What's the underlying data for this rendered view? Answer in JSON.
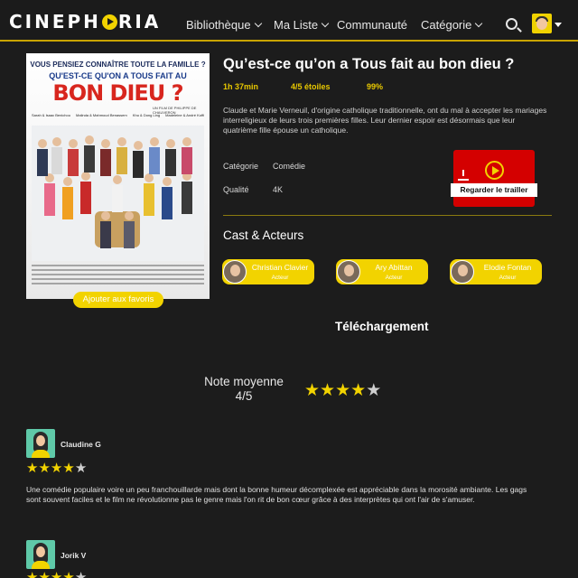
{
  "nav": {
    "logo": [
      "CINEPH",
      "RIA"
    ],
    "items": [
      {
        "label": "Bibliothèque",
        "dropdown": true
      },
      {
        "label": "Ma Liste",
        "dropdown": true
      },
      {
        "label": "Communauté",
        "dropdown": false
      },
      {
        "label": "Catégorie",
        "dropdown": true
      }
    ],
    "search_icon": "search-icon",
    "avatar_icon": "user-avatar"
  },
  "poster": {
    "tagline": "VOUS PENSIEZ CONNAÎTRE TOUTE LA FAMILLE ?",
    "title_line1": "QU'EST-CE QU'ON A TOUS FAIT AU",
    "title_line2": "BON DIEU ?",
    "director": "UN FILM DE PHILIPPE DE CHAUVERON",
    "couples": [
      "Sarah & Isaac Benichou",
      "Malinda & Mahmoud Benassem",
      "Khu & Dong Ling",
      "Madeleine & André Koffi"
    ]
  },
  "favorite_button": "Ajouter aux favoris",
  "movie": {
    "title": "Qu’est-ce qu’on a Tous fait au bon dieu ?",
    "duration": "1h 37min",
    "rating": "4/5 étoiles",
    "score": "99%",
    "synopsis": "Claude et Marie Verneuil, d'origine catholique traditionnelle, ont du mal à accepter les mariages interreligieux de leurs trois premières filles. Leur dernier espoir est désormais que leur quatrième fille épouse un catholique.",
    "category_label": "Catégorie",
    "category_value": "Comédie",
    "quality_label": "Qualité",
    "quality_value": "4K"
  },
  "trailer": {
    "label": "Regarder le trailler",
    "color": "#d40000"
  },
  "cast": {
    "heading": "Cast & Acteurs",
    "members": [
      {
        "name": "Christian Clavier",
        "role": "Acteur"
      },
      {
        "name": "Ary Abittan",
        "role": "Acteur"
      },
      {
        "name": "Elodie Fontan",
        "role": "Acteur"
      }
    ]
  },
  "download_heading": "Téléchargement",
  "average": {
    "label": "Note moyenne",
    "value": "4/5",
    "stars": 4
  },
  "reviews": [
    {
      "author": "Claudine G",
      "stars": 4,
      "text": "Une comédie populaire voire un peu franchouillarde mais dont la bonne humeur décomplexée est appréciable dans la morosité ambiante. Les gags sont souvent faciles et le film ne révolutionne pas le genre mais l'on rit de bon cœur grâce à des interprètes qui ont l'air de s'amuser."
    },
    {
      "author": "Jorik V",
      "stars": 4,
      "text": ""
    }
  ],
  "colors": {
    "accent": "#f2d300",
    "background": "#1c1c1c",
    "trailer": "#d40000"
  }
}
